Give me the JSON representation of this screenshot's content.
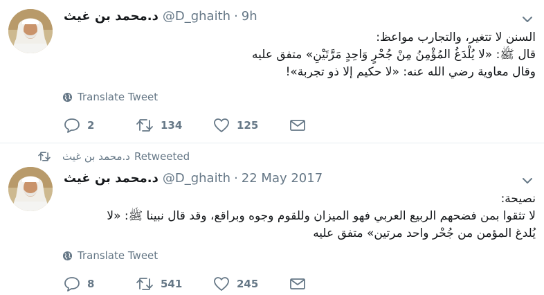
{
  "tweets": [
    {
      "author_name": "د.محمد بن غيث",
      "handle": "@D_ghaith",
      "separator": "·",
      "time": "9h",
      "lines": [
        "السنن لا تتغير، والتجارب مواعظ:",
        "قال ﷺ: «لا يُلْدَغُ المُؤْمِنُ مِنْ جُحْرٍ وَاحِدٍ مَرَّتَيْنِ» متفق عليه",
        "وقال معاوية رضي الله عنه: «لا حكيم إلا ذو تجربة»!"
      ],
      "translate_label": "Translate Tweet",
      "replies": "2",
      "retweets": "134",
      "likes": "125"
    },
    {
      "retweet_context": {
        "name": "د.محمد بن غيث",
        "label": "Retweeted"
      },
      "author_name": "د.محمد بن غيث",
      "handle": "@D_ghaith",
      "separator": "·",
      "time": "22 May 2017",
      "lines": [
        "نصيحة:",
        "لا تثقوا بمن فضحهم الربيع العربي فهو الميزان وللقوم وجوه وبراقع، وقد قال نبينا ﷺ: «لا",
        "يُلدغ المؤمن من جُحْر واحد مرتين» متفق عليه"
      ],
      "translate_label": "Translate Tweet",
      "replies": "8",
      "retweets": "541",
      "likes": "245"
    }
  ],
  "icons": {
    "reply": "reply-icon",
    "retweet": "retweet-icon",
    "like": "heart-icon",
    "dm": "envelope-icon",
    "globe": "globe-icon",
    "caret": "chevron-down-icon"
  },
  "colors": {
    "text": "#14171a",
    "muted": "#657786",
    "divider": "#e6ecf0"
  }
}
